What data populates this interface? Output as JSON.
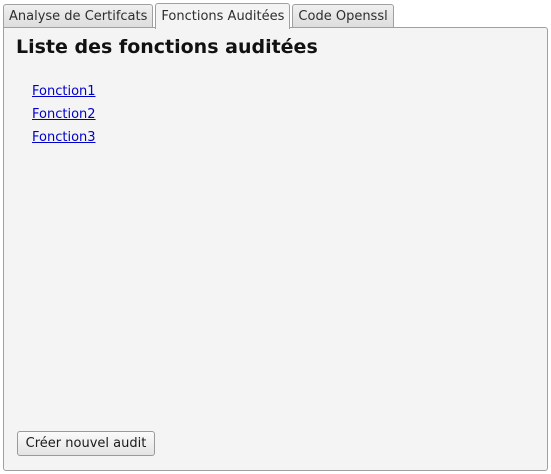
{
  "tabs": [
    {
      "label": "Analyse de Certifcats",
      "active": false
    },
    {
      "label": "Fonctions Auditées",
      "active": true
    },
    {
      "label": "Code Openssl",
      "active": false
    }
  ],
  "panel": {
    "title": "Liste des fonctions auditées",
    "functions": [
      "Fonction1",
      "Fonction2",
      "Fonction3"
    ],
    "create_button_label": "Créer nouvel audit"
  }
}
